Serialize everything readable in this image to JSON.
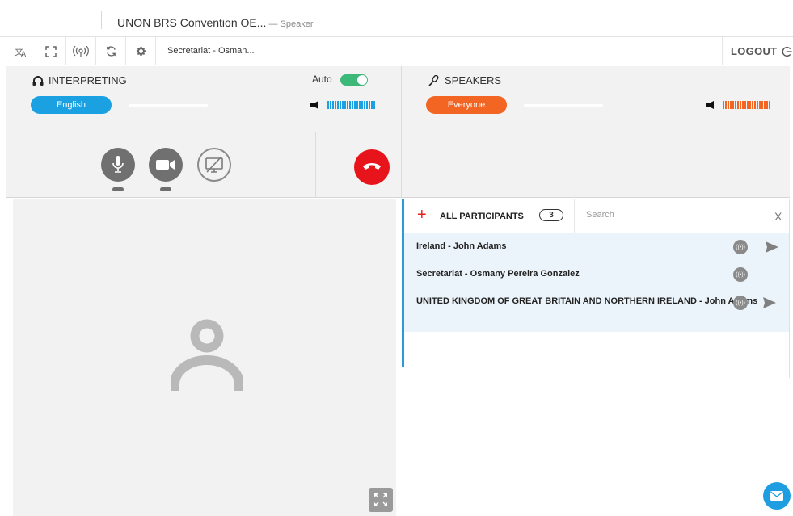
{
  "window": {
    "title": "UNON BRS Convention OE...",
    "subtitle": " — Speaker"
  },
  "toolbar": {
    "icons": [
      "translate-icon",
      "fullscreen-icon",
      "broadcast-icon",
      "refresh-icon",
      "gear-icon"
    ],
    "room_label": "Secretariat - Osman...",
    "logout_label": "LOGOUT"
  },
  "interpreting": {
    "heading": "INTERPRETING",
    "auto_label": "Auto",
    "auto_on": true,
    "language": "English",
    "accent_color": "#1ba1e2"
  },
  "speakers": {
    "heading": "SPEAKERS",
    "selection": "Everyone",
    "accent_color": "#f26522"
  },
  "call_controls": {
    "mic_icon": "microphone-icon",
    "camera_icon": "camera-icon",
    "screenshare_icon": "screen-share-off-icon",
    "hangup_icon": "hang-up-icon",
    "hangup_color": "#e8141c"
  },
  "participants": {
    "header": "ALL PARTICIPANTS",
    "count": "3",
    "search_placeholder": "Search",
    "close_label": "X",
    "list": [
      {
        "name": "Ireland - John Adams",
        "has_send": true
      },
      {
        "name": "Secretariat - Osmany Pereira Gonzalez",
        "has_send": false
      },
      {
        "name": "UNITED KINGDOM OF GREAT BRITAIN AND NORTHERN IRELAND - John Adams",
        "has_send": true
      }
    ]
  }
}
